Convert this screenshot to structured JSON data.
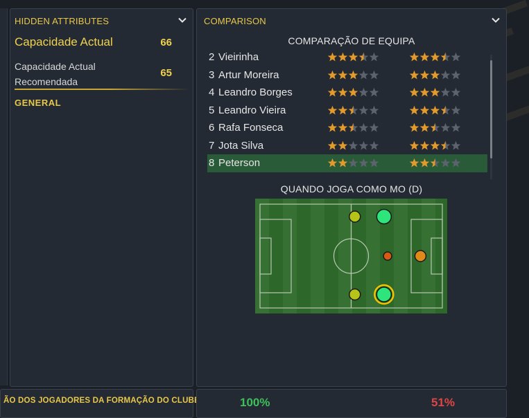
{
  "hidden": {
    "title": "HIDDEN ATTRIBUTES",
    "attr1": {
      "label": "Capacidade Actual",
      "value": "66"
    },
    "attr2": {
      "label_line1": "Capacidade Actual",
      "label_line2": "Recomendada",
      "value": "65"
    },
    "section": "GENERAL"
  },
  "comparison": {
    "title": "COMPARISON",
    "subtitle": "COMPARAÇÃO DE EQUIPA",
    "players": [
      {
        "num": "2",
        "name": "Vieirinha",
        "current": 3.5,
        "potential": 3.5,
        "selected": false
      },
      {
        "num": "3",
        "name": "Artur Moreira",
        "current": 3,
        "potential": 3,
        "selected": false
      },
      {
        "num": "4",
        "name": "Leandro Borges",
        "current": 3,
        "potential": 3,
        "selected": false
      },
      {
        "num": "5",
        "name": "Leandro Vieira",
        "current": 2.5,
        "potential": 3.5,
        "selected": false
      },
      {
        "num": "6",
        "name": "Rafa Fonseca",
        "current": 2.5,
        "potential": 2.5,
        "selected": false
      },
      {
        "num": "7",
        "name": "Jota Silva",
        "current": 2,
        "potential": 3.5,
        "selected": false
      },
      {
        "num": "8",
        "name": "Peterson",
        "current": 2,
        "potential": 2.5,
        "selected": true
      }
    ],
    "position_title": "QUANDO JOGA COMO MO (D)",
    "pitch_positions": [
      {
        "col": 0.52,
        "row": 0.12,
        "color": "#b6c41a",
        "size": "small",
        "highlight": false
      },
      {
        "col": 0.68,
        "row": 0.12,
        "color": "#2ee57c",
        "size": "large",
        "highlight": false
      },
      {
        "col": 0.7,
        "row": 0.5,
        "color": "#d65a10",
        "size": "tiny",
        "highlight": false
      },
      {
        "col": 0.88,
        "row": 0.5,
        "color": "#e08a18",
        "size": "small",
        "highlight": false
      },
      {
        "col": 0.52,
        "row": 0.87,
        "color": "#b6c41a",
        "size": "small",
        "highlight": false
      },
      {
        "col": 0.68,
        "row": 0.87,
        "color": "#2ee57c",
        "size": "large",
        "highlight": true
      }
    ]
  },
  "bottom": {
    "text": "ÃO DOS JOGADORES DA FORMAÇÃO DO CLUBE",
    "pct_left": "100%",
    "pct_left_color": "#3fbf5a",
    "pct_right": "51%",
    "pct_right_color": "#e04444"
  },
  "colors": {
    "accent": "#e8c84a",
    "star_gold": "#e39a2c",
    "star_empty": "#5d636c",
    "selected_row": "#2a5b39"
  }
}
